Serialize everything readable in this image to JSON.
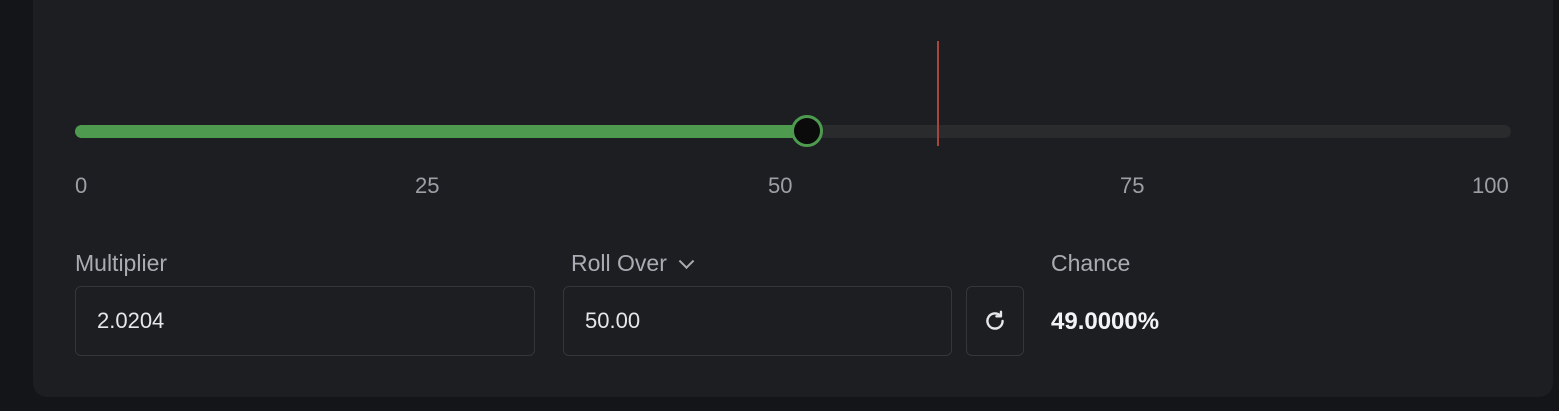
{
  "slider": {
    "min": 0,
    "max": 100,
    "value": 51,
    "result_marker": 60,
    "fill_color": "#4e9b50",
    "marker_color": "#a5473e",
    "ticks": [
      "0",
      "25",
      "50",
      "75",
      "100"
    ]
  },
  "multiplier": {
    "label": "Multiplier",
    "value": "2.0204"
  },
  "roll_over": {
    "label": "Roll Over",
    "value": "50.00"
  },
  "chance": {
    "label": "Chance",
    "value": "49.0000%"
  },
  "icons": {
    "mode_dropdown": "chevron-down-icon",
    "refresh": "refresh-icon"
  }
}
